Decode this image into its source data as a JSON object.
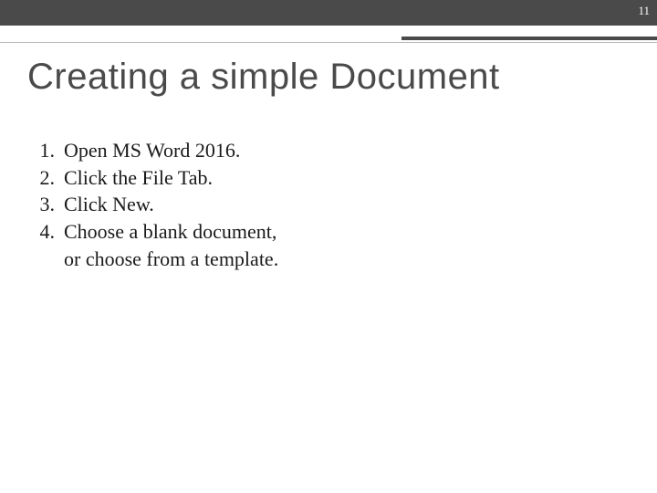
{
  "header": {
    "page_number": "11"
  },
  "title": "Creating a simple Document",
  "steps": [
    {
      "num": "1.",
      "text": "Open MS Word 2016."
    },
    {
      "num": "2.",
      "text": "Click the File Tab."
    },
    {
      "num": "3.",
      "text": "Click New."
    },
    {
      "num": "4.",
      "text": "Choose a blank document, or choose from a template."
    }
  ]
}
